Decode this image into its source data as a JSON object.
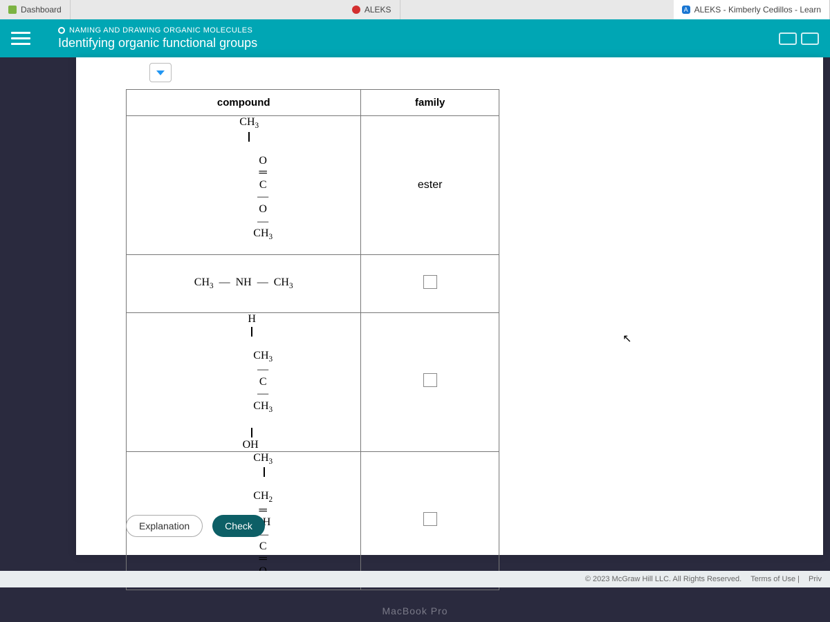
{
  "browser": {
    "tabs": {
      "dashboard": "Dashboard",
      "aleks": "ALEKS",
      "learn": "ALEKS - Kimberly Cedillos - Learn"
    }
  },
  "header": {
    "overline": "NAMING AND DRAWING ORGANIC MOLECULES",
    "title": "Identifying organic functional groups"
  },
  "table": {
    "col1": "compound",
    "col2": "family",
    "rows": {
      "r1": {
        "compound_top": "CH",
        "compound_sub1": "3",
        "compound_bottom_left": "O",
        "compound_bottom_mid": "C",
        "compound_bottom_o": "O",
        "compound_bottom_right": "CH",
        "compound_sub2": "3",
        "family": "ester"
      },
      "r2": {
        "left": "CH",
        "sub1": "3",
        "mid": "NH",
        "right": "CH",
        "sub2": "3"
      },
      "r3": {
        "top": "H",
        "left": "CH",
        "sub1": "3",
        "center": "C",
        "right": "CH",
        "sub2": "3",
        "bottom": "OH"
      },
      "r4": {
        "top": "CH",
        "topsub": "3",
        "l1": "CH",
        "s1": "2",
        "l2": "CH",
        "l3": "C",
        "l4": "O"
      }
    }
  },
  "buttons": {
    "explanation": "Explanation",
    "check": "Check"
  },
  "footer": {
    "copyright": "© 2023 McGraw Hill LLC. All Rights Reserved.",
    "terms": "Terms of Use",
    "privacy": "Priv"
  },
  "device": "MacBook Pro"
}
